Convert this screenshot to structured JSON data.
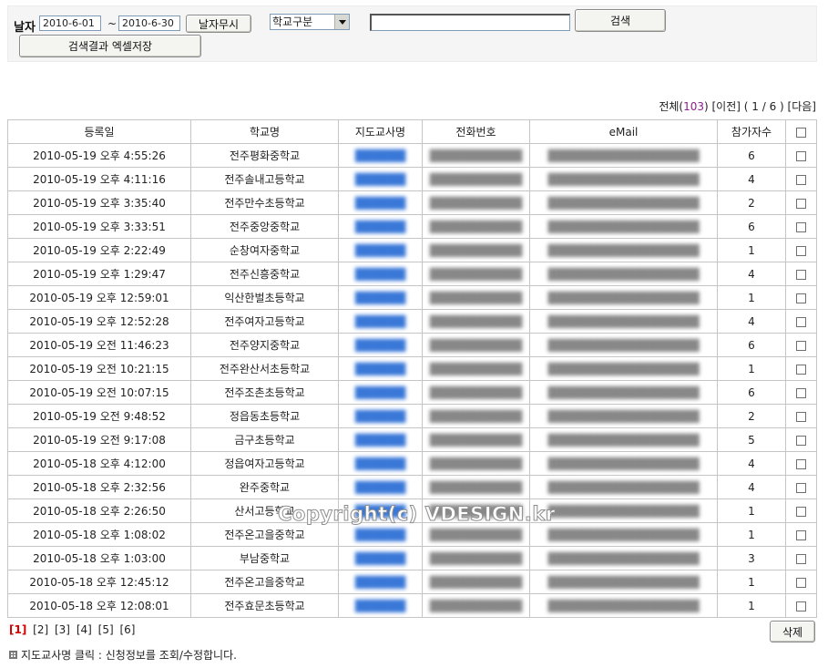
{
  "filter": {
    "date_label": "날자",
    "start_date": "2010-6-01",
    "separator": "~",
    "end_date": "2010-6-30",
    "ignore_date_button": "날자무시",
    "school_type_selected": "학교구분",
    "search_value": "",
    "search_button": "검색",
    "excel_button": "검색결과 엑셀저장"
  },
  "pager_top": {
    "total_label": "전체(",
    "total_count": "103",
    "total_close": ")",
    "prev": "[이전]",
    "page_info": "( 1 / 6 )",
    "next": "[다음]"
  },
  "table": {
    "headers": [
      "등록일",
      "학교명",
      "지도교사명",
      "전화번호",
      "eMail",
      "참가자수"
    ],
    "rows": [
      {
        "date": "2010-05-19 오후 4:55:26",
        "school": "전주평화중학교",
        "teacher": "██████",
        "phone": "███████████",
        "email": "██████████████████",
        "count": "6"
      },
      {
        "date": "2010-05-19 오후 4:11:16",
        "school": "전주솔내고등학교",
        "teacher": "██████",
        "phone": "███████████",
        "email": "██████████████████",
        "count": "4"
      },
      {
        "date": "2010-05-19 오후 3:35:40",
        "school": "전주만수초등학교",
        "teacher": "██████",
        "phone": "███████████",
        "email": "██████████████████",
        "count": "2"
      },
      {
        "date": "2010-05-19 오후 3:33:51",
        "school": "전주중앙중학교",
        "teacher": "██████",
        "phone": "███████████",
        "email": "██████████████████",
        "count": "6"
      },
      {
        "date": "2010-05-19 오후 2:22:49",
        "school": "순창여자중학교",
        "teacher": "██████",
        "phone": "███████████",
        "email": "██████████████████",
        "count": "1"
      },
      {
        "date": "2010-05-19 오후 1:29:47",
        "school": "전주신흥중학교",
        "teacher": "██████",
        "phone": "███████████",
        "email": "██████████████████",
        "count": "4"
      },
      {
        "date": "2010-05-19 오후 12:59:01",
        "school": "익산한벌초등학교",
        "teacher": "██████",
        "phone": "███████████",
        "email": "██████████████████",
        "count": "1"
      },
      {
        "date": "2010-05-19 오후 12:52:28",
        "school": "전주여자고등학교",
        "teacher": "██████",
        "phone": "███████████",
        "email": "██████████████████",
        "count": "4"
      },
      {
        "date": "2010-05-19 오전 11:46:23",
        "school": "전주양지중학교",
        "teacher": "██████",
        "phone": "███████████",
        "email": "██████████████████",
        "count": "6"
      },
      {
        "date": "2010-05-19 오전 10:21:15",
        "school": "전주완산서초등학교",
        "teacher": "██████",
        "phone": "███████████",
        "email": "██████████████████",
        "count": "1"
      },
      {
        "date": "2010-05-19 오전 10:07:15",
        "school": "전주조촌초등학교",
        "teacher": "██████",
        "phone": "███████████",
        "email": "██████████████████",
        "count": "6"
      },
      {
        "date": "2010-05-19 오전 9:48:52",
        "school": "정읍동초등학교",
        "teacher": "██████",
        "phone": "███████████",
        "email": "██████████████████",
        "count": "2"
      },
      {
        "date": "2010-05-19 오전 9:17:08",
        "school": "금구초등학교",
        "teacher": "██████",
        "phone": "███████████",
        "email": "██████████████████",
        "count": "5"
      },
      {
        "date": "2010-05-18 오후 4:12:00",
        "school": "정읍여자고등학교",
        "teacher": "██████",
        "phone": "███████████",
        "email": "██████████████████",
        "count": "4"
      },
      {
        "date": "2010-05-18 오후 2:32:56",
        "school": "완주중학교",
        "teacher": "██████",
        "phone": "███████████",
        "email": "██████████████████",
        "count": "4"
      },
      {
        "date": "2010-05-18 오후 2:26:50",
        "school": "산서고등학교",
        "teacher": "██████",
        "phone": "███████████",
        "email": "██████████████████",
        "count": "1"
      },
      {
        "date": "2010-05-18 오후 1:08:02",
        "school": "전주온고을중학교",
        "teacher": "██████",
        "phone": "███████████",
        "email": "██████████████████",
        "count": "1"
      },
      {
        "date": "2010-05-18 오후 1:03:00",
        "school": "부남중학교",
        "teacher": "██████",
        "phone": "███████████",
        "email": "██████████████████",
        "count": "3"
      },
      {
        "date": "2010-05-18 오후 12:45:12",
        "school": "전주온고을중학교",
        "teacher": "██████",
        "phone": "███████████",
        "email": "██████████████████",
        "count": "1"
      },
      {
        "date": "2010-05-18 오후 12:08:01",
        "school": "전주효문초등학교",
        "teacher": "██████",
        "phone": "███████████",
        "email": "██████████████████",
        "count": "1"
      }
    ]
  },
  "watermark": "Copyright(c) VDESIGN.kr",
  "pagination": [
    "[1]",
    "[2]",
    "[3]",
    "[4]",
    "[5]",
    "[6]"
  ],
  "delete_button": "삭제",
  "help_text": "지도교사명 클릭 : 신청정보를 조회/수정합니다.",
  "colors": {
    "current_page": "#d40000",
    "count_highlight": "#8b1f8b",
    "teacher_link": "#3a78d8"
  }
}
